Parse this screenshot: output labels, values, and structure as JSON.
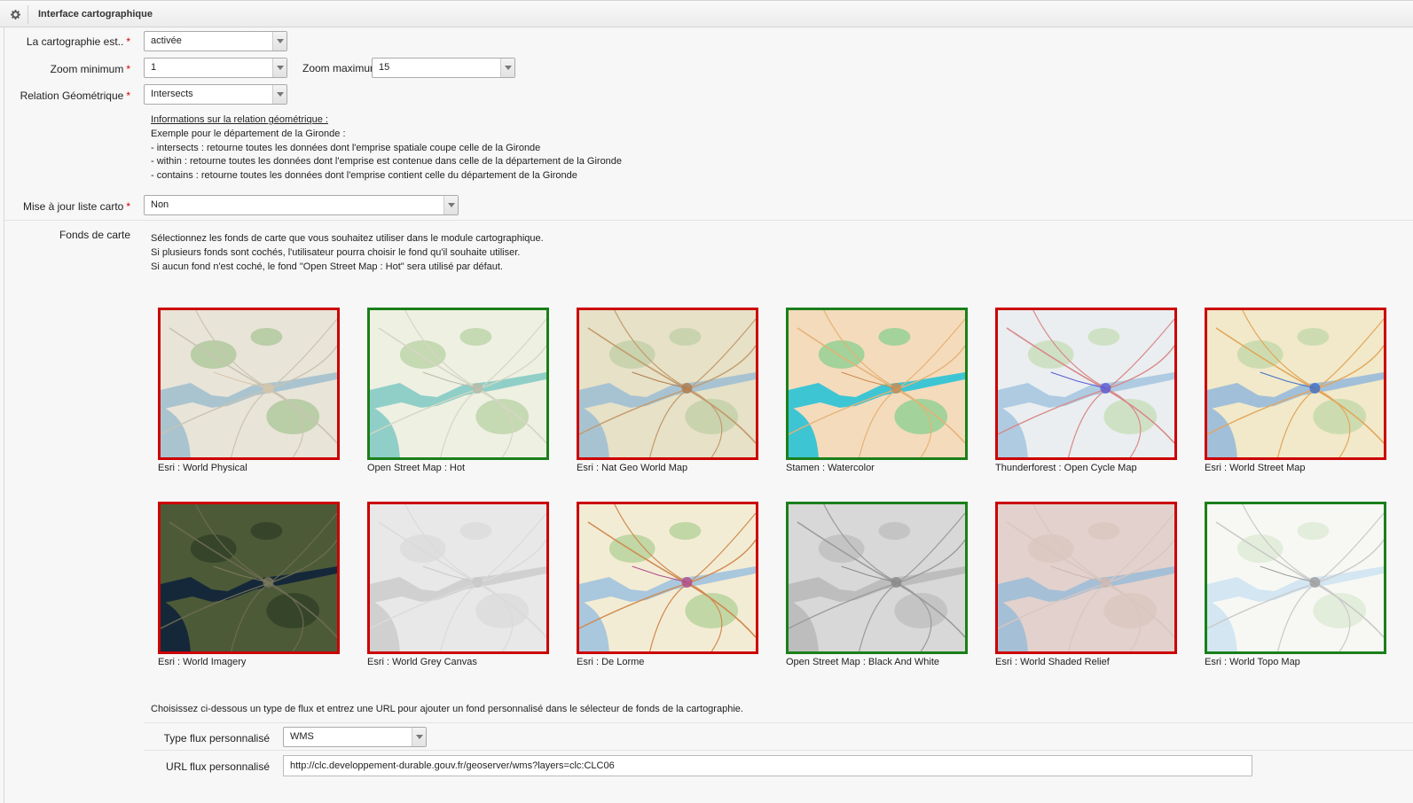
{
  "panel": {
    "title": "Interface cartographique"
  },
  "form": {
    "mapping_state": {
      "label": "La cartographie est..",
      "value": "activée"
    },
    "zoom_min": {
      "label": "Zoom minimum",
      "value": "1"
    },
    "zoom_max": {
      "label": "Zoom maximum",
      "value": "15"
    },
    "geo_relation": {
      "label": "Relation Géométrique",
      "value": "Intersects"
    },
    "info": {
      "heading": "Informations sur la relation géométrique :",
      "lines": [
        "Exemple pour le département de la Gironde :",
        "- intersects : retourne toutes les données dont l'emprise spatiale coupe celle de la Gironde",
        "- within : retourne toutes les données dont l'emprise est contenue dans celle de la département de la Gironde",
        "- contains : retourne toutes les données dont l'emprise contient celle du département de la Gironde"
      ]
    },
    "update_list": {
      "label": "Mise à jour liste carto",
      "value": "Non"
    }
  },
  "basemaps": {
    "label": "Fonds de carte",
    "help": [
      "Sélectionnez les fonds de carte que vous souhaitez utiliser dans le module cartographique.",
      "Si plusieurs fonds sont cochés, l'utilisateur pourra choisir le fond qu'il souhaite utiliser.",
      "Si aucun fond n'est coché, le fond \"Open Street Map : Hot\" sera utilisé par défaut."
    ],
    "tiles": [
      {
        "name": "Esri : World Physical",
        "selected": false,
        "style": "physical"
      },
      {
        "name": "Open Street Map : Hot",
        "selected": true,
        "style": "hot"
      },
      {
        "name": "Esri : Nat Geo World Map",
        "selected": false,
        "style": "natgeo"
      },
      {
        "name": "Stamen : Watercolor",
        "selected": true,
        "style": "watercolor"
      },
      {
        "name": "Thunderforest : Open Cycle Map",
        "selected": false,
        "style": "cycle"
      },
      {
        "name": "Esri : World Street Map",
        "selected": false,
        "style": "street"
      },
      {
        "name": "Esri : World Imagery",
        "selected": false,
        "style": "imagery"
      },
      {
        "name": "Esri : World Grey Canvas",
        "selected": false,
        "style": "grey"
      },
      {
        "name": "Esri : De Lorme",
        "selected": false,
        "style": "delorme"
      },
      {
        "name": "Open Street Map : Black And White",
        "selected": true,
        "style": "bw"
      },
      {
        "name": "Esri : World Shaded Relief",
        "selected": false,
        "style": "relief"
      },
      {
        "name": "Esri : World Topo Map",
        "selected": true,
        "style": "topo"
      }
    ]
  },
  "custom": {
    "intro": "Choisissez ci-dessous un type de flux et entrez une URL pour ajouter un fond personnalisé dans le sélecteur de fonds de la cartographie.",
    "type_label": "Type flux personnalisé",
    "type_value": "WMS",
    "url_label": "URL flux personnalisé",
    "url_value": "http://clc.developpement-durable.gouv.fr/geoserver/wms?layers=clc:CLC06"
  },
  "colors": {
    "selected": "#1a7f1a",
    "unselected": "#cc0000",
    "required": "#d10000"
  }
}
